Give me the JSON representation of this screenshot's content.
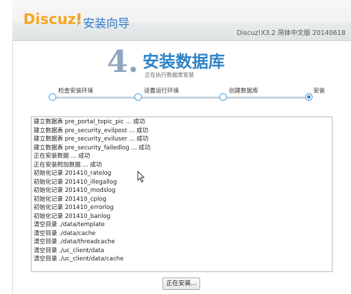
{
  "header": {
    "logo_main": "Discuz",
    "logo_mark": "!",
    "title": "安装向导",
    "version": "Discuz!X3.2 简体中文版 20140618"
  },
  "step": {
    "number": "4.",
    "title": "安装数据库",
    "subtitle": "正在执行数据库安装"
  },
  "progress": {
    "steps": [
      {
        "label": "检查安装环境"
      },
      {
        "label": "设置运行环境"
      },
      {
        "label": "创建数据库"
      },
      {
        "label": "安装"
      }
    ],
    "active_index": 3
  },
  "log": [
    "建立数据表 pre_portal_topic_pic ... 成功",
    "建立数据表 pre_security_evilpost ... 成功",
    "建立数据表 pre_security_eviluser ... 成功",
    "建立数据表 pre_security_failedlog ... 成功",
    "正在安装数据 ... 成功",
    "正在安装附加数据 ... 成功",
    "初始化记录 201410_ratelog",
    "初始化记录 201410_illegallog",
    "初始化记录 201410_modslog",
    "初始化记录 201410_cplog",
    "初始化记录 201410_errorlog",
    "初始化记录 201410_banlog",
    "清空目录 ./data/template",
    "清空目录 ./data/cache",
    "清空目录 ./data/threadcache",
    "清空目录 ./uc_client/data",
    "清空目录 ./uc_client/data/cache"
  ],
  "button": {
    "label": "正在安装..."
  },
  "colors": {
    "accent": "#2b7ac9",
    "logo": "#f6a623"
  }
}
